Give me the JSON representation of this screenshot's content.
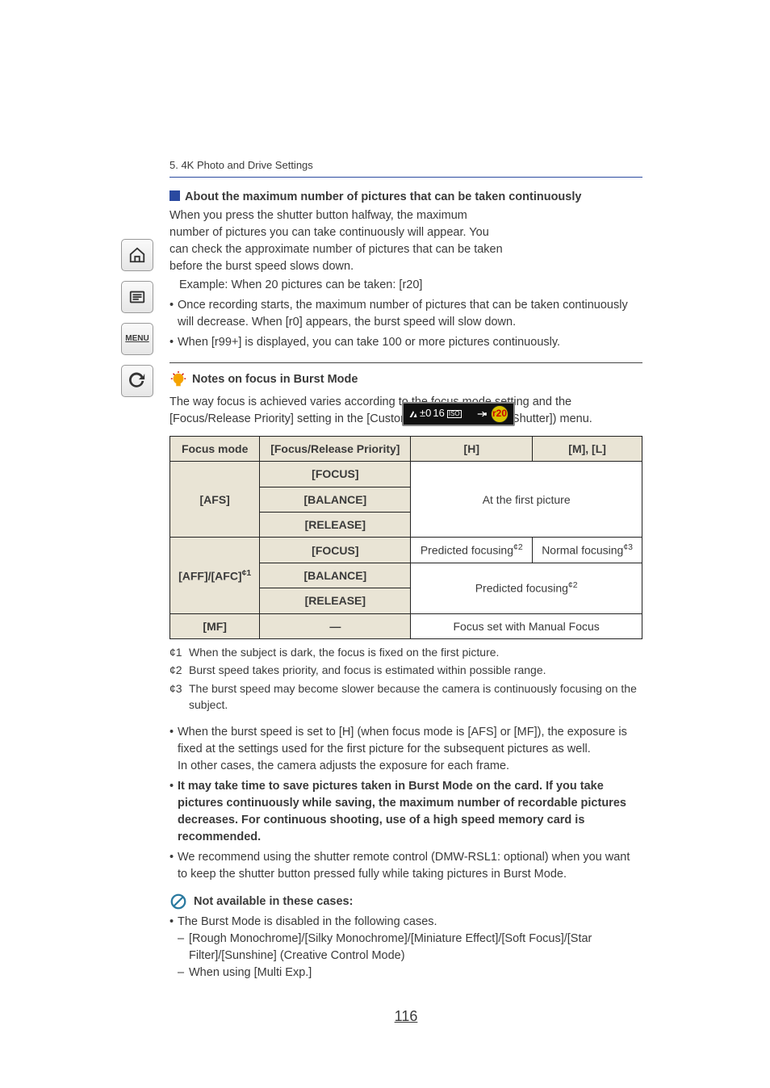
{
  "breadcrumb": "5. 4K Photo and Drive Settings",
  "about": {
    "heading": "About the maximum number of pictures that can be taken continuously",
    "p1": "When you press the shutter button halfway, the maximum number of pictures you can take continuously will appear. You can check the approximate number of pictures that can be taken before the burst speed slows down.",
    "example": "Example: When 20 pictures can be taken: [r20]",
    "b1": "Once recording starts, the maximum number of pictures that can be taken continuously will decrease. When [r0] appears, the burst speed will slow down.",
    "b2": "When [r99+] is displayed, you can take 100 or more pictures continuously."
  },
  "display": {
    "ev": "±0",
    "shots": "16",
    "badge": "r20"
  },
  "notes": {
    "title": "Notes on focus in Burst Mode",
    "p1": "The way focus is achieved varies according to the focus mode setting and the [Focus/Release Priority] setting in the [Custom] ([Focus / Release Shutter]) menu."
  },
  "table": {
    "h1": "Focus mode",
    "h2": "[Focus/Release Priority]",
    "h3": "[H]",
    "h4": "[M], [L]",
    "afs": "[AFS]",
    "focus": "[FOCUS]",
    "balance": "[BALANCE]",
    "release": "[RELEASE]",
    "aff_afc": "[AFF]/[AFC]",
    "aff_sup": "¢1",
    "mf": "[MF]",
    "dash": "—",
    "at_first": "At the first picture",
    "predicted": "Predicted focusing",
    "pred_sup": "¢2",
    "normal": "Normal focusing",
    "norm_sup": "¢3",
    "mf_set": "Focus set with Manual Focus"
  },
  "footnotes": {
    "f1_lbl": "¢1",
    "f1": "When the subject is dark, the focus is fixed on the first picture.",
    "f2_lbl": "¢2",
    "f2": "Burst speed takes priority, and focus is estimated within possible range.",
    "f3_lbl": "¢3",
    "f3": "The burst speed may become slower because the camera is continuously focusing on the subject."
  },
  "bullets2": {
    "b1a": "When the burst speed is set to [H] (when focus mode is [AFS] or [MF]), the exposure is fixed at the settings used for the first picture for the subsequent pictures as well.",
    "b1b": "In other cases, the camera adjusts the exposure for each frame.",
    "b2": "It may take time to save pictures taken in Burst Mode on the card. If you take pictures continuously while saving, the maximum number of recordable pictures decreases. For continuous shooting, use of a high speed memory card is recommended.",
    "b3": "We recommend using the shutter remote control (DMW-RSL1: optional) when you want to keep the shutter button pressed fully while taking pictures in Burst Mode."
  },
  "na": {
    "title": "Not available in these cases:",
    "p1": "The Burst Mode is disabled in the following cases.",
    "d1": "[Rough Monochrome]/[Silky Monochrome]/[Miniature Effect]/[Soft Focus]/[Star Filter]/[Sunshine] (Creative Control Mode)",
    "d2": "When using [Multi Exp.]"
  },
  "pagenum": "116",
  "sidebar": {
    "menu": "MENU"
  }
}
